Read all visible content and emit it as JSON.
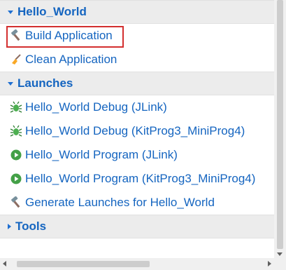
{
  "sections": [
    {
      "title": "Hello_World",
      "expanded": true,
      "items": [
        {
          "label": "Build Application",
          "icon": "hammer-icon",
          "highlighted": true
        },
        {
          "label": "Clean Application",
          "icon": "broom-icon"
        }
      ]
    },
    {
      "title": "Launches",
      "expanded": true,
      "items": [
        {
          "label": "Hello_World Debug (JLink)",
          "icon": "debug-bug-icon"
        },
        {
          "label": "Hello_World Debug (KitProg3_MiniProg4)",
          "icon": "debug-bug-icon"
        },
        {
          "label": "Hello_World Program (JLink)",
          "icon": "run-play-icon"
        },
        {
          "label": "Hello_World Program (KitProg3_MiniProg4)",
          "icon": "run-play-icon"
        },
        {
          "label": "Generate Launches for Hello_World",
          "icon": "hammer-icon"
        }
      ]
    },
    {
      "title": "Tools",
      "expanded": false,
      "items": []
    }
  ],
  "colors": {
    "link": "#1565c0",
    "header_bg": "#ececec",
    "highlight_border": "#d32f2f"
  }
}
